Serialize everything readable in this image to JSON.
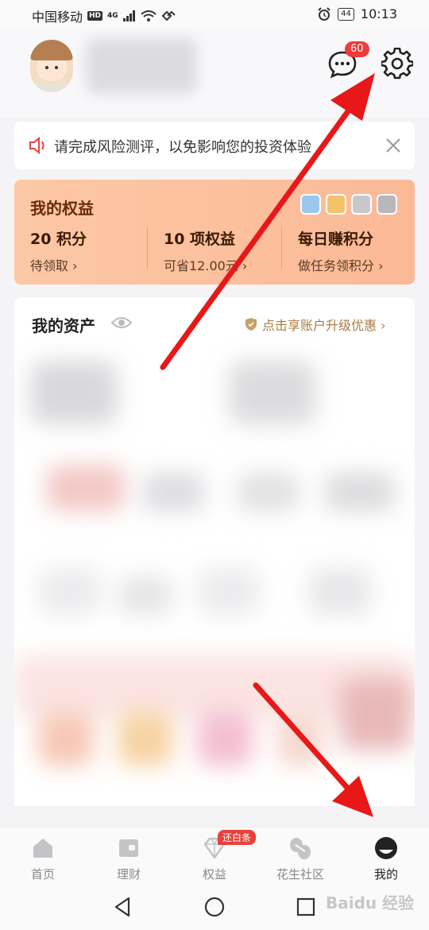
{
  "status_bar": {
    "carrier": "中国移动",
    "hd": "HD",
    "network": "4G",
    "battery": "44",
    "time": "10:13"
  },
  "header": {
    "message_badge": "60",
    "icons": [
      "avatar",
      "message-icon",
      "gear-icon"
    ]
  },
  "notice": {
    "text": "请完成风险测评，以免影响您的投资体验"
  },
  "equity": {
    "title": "我的权益",
    "items": [
      {
        "main": "20 积分",
        "sub": "待领取 ›"
      },
      {
        "main": "10 项权益",
        "sub": "可省12.00元 ›"
      },
      {
        "main": "每日赚积分",
        "sub": "做任务领积分 ›"
      }
    ]
  },
  "assets": {
    "title": "我的资产",
    "upgrade": "点击享账户升级优惠 ›"
  },
  "tabbar": {
    "badge": "还白条",
    "tabs": [
      {
        "label": "首页",
        "icon": "home-icon"
      },
      {
        "label": "理财",
        "icon": "wallet-icon"
      },
      {
        "label": "权益",
        "icon": "diamond-icon"
      },
      {
        "label": "花生社区",
        "icon": "peanut-icon"
      },
      {
        "label": "我的",
        "icon": "profile-icon"
      }
    ]
  },
  "watermark": "Baidu 经验",
  "colors": {
    "accent_red": "#ef3b3b",
    "equity_bg": "#fcc8a6",
    "gold": "#a87c45"
  }
}
